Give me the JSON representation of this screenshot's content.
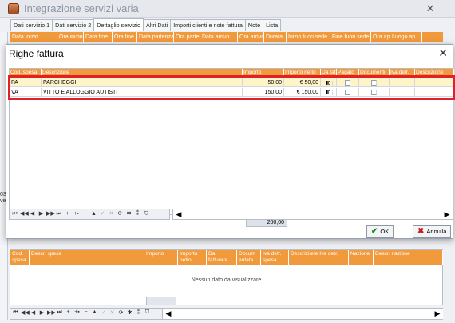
{
  "window": {
    "title": "Integrazione servizi varia",
    "close": "✕"
  },
  "tabs": [
    "Dati servizio 1",
    "Dati servizio 2",
    "Dettaglio servizio",
    "Altri Dati",
    "Importi clienti e note fattura",
    "Note",
    "Lista"
  ],
  "active_tab": "Dettaglio servizio",
  "bg_columns": [
    "Data inizio",
    "Ora inizio",
    "Data fine",
    "Ora fine",
    "Data partenza",
    "Ora parten",
    "Data arrivo",
    "Ora arrivo",
    "Durata",
    "Inizio fuori sede",
    "Fine fuori sede",
    "Ora ap",
    "Luogo ap"
  ],
  "left_strip": [
    "03",
    "ve"
  ],
  "dialog": {
    "title": "Righe fattura",
    "close": "✕",
    "columns": [
      "Cod. spesa",
      "Descrizione",
      "Importo",
      "Importo netto",
      "Da fattu",
      "Pagato",
      "Documenti",
      "Iva detr.",
      "Descrizione"
    ],
    "rows": [
      {
        "cod": "PA",
        "desc": "PARCHEGGI",
        "importo": "50,00",
        "netto": "€ 50,00",
        "fattura_icon": "bars-icon"
      },
      {
        "cod": "VA",
        "desc": "VITTO E ALLOGGIO AUTISTI",
        "importo": "150,00",
        "netto": "€ 150,00",
        "fattura_icon": "bars-icon"
      }
    ],
    "total": "200,00",
    "ok_label": "OK",
    "cancel_label": "Annulla"
  },
  "nav_glyphs": [
    "⏮",
    "◀◀",
    "◀",
    "▶",
    "▶▶",
    "⏭",
    "+",
    "+▪",
    "−",
    "▲",
    "✓",
    "✕",
    "⟳",
    "✱",
    "⁑",
    "⛉"
  ],
  "lower_grid": {
    "columns": [
      "Cod. spesa",
      "Descr. spesa",
      "Importo",
      "Importo netto",
      "Da fatturare",
      "Docum entata",
      "Iva detr. spesa",
      "Descrizione Iva detr.",
      "Nazione",
      "Descr. nazione"
    ],
    "empty_text": "Nessun dato da visualizzare"
  },
  "colors": {
    "header": "#f19a3c",
    "selected_row": "#fdf5c9",
    "highlight": "#e2202a"
  }
}
